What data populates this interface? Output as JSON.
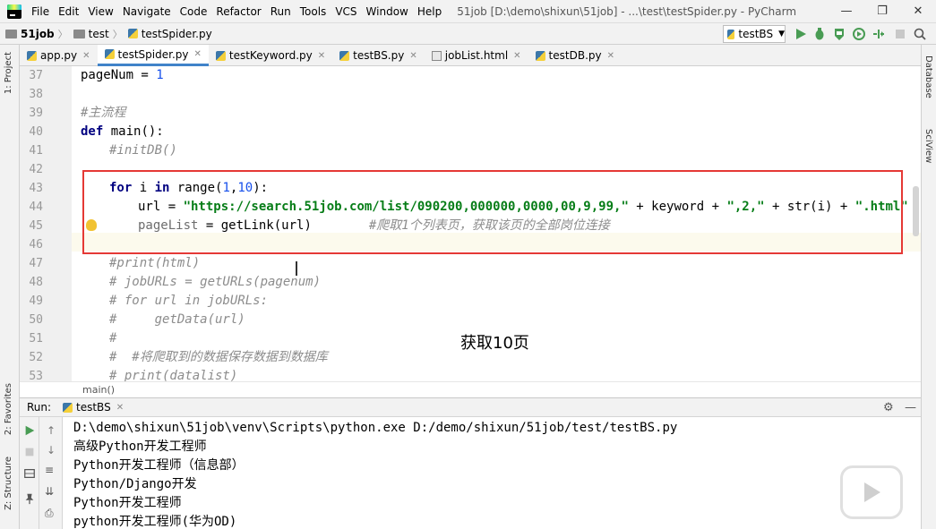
{
  "menubar": {
    "items": [
      "File",
      "Edit",
      "View",
      "Navigate",
      "Code",
      "Refactor",
      "Run",
      "Tools",
      "VCS",
      "Window",
      "Help"
    ],
    "window_title": "51job [D:\\demo\\shixun\\51job] - ...\\test\\testSpider.py - PyCharm",
    "minimize": "—",
    "maximize": "❐",
    "close": "✕"
  },
  "navbar": {
    "crumbs": [
      "51job",
      "test",
      "testSpider.py"
    ],
    "run_config": "testBS"
  },
  "tabs": [
    {
      "label": "app.py",
      "icon": "python-file-icon"
    },
    {
      "label": "testSpider.py",
      "icon": "python-file-icon"
    },
    {
      "label": "testKeyword.py",
      "icon": "python-file-icon"
    },
    {
      "label": "testBS.py",
      "icon": "python-file-icon"
    },
    {
      "label": "jobList.html",
      "icon": "html-file-icon"
    },
    {
      "label": "testDB.py",
      "icon": "python-file-icon"
    }
  ],
  "left_strip": {
    "project": "1: Project",
    "favorites": "2: Favorites",
    "structure": "Z: Structure"
  },
  "right_strip": {
    "database": "Database",
    "sciview": "SciView"
  },
  "editor": {
    "line_numbers": [
      "37",
      "38",
      "39",
      "40",
      "41",
      "42",
      "43",
      "44",
      "45",
      "46",
      "47",
      "48",
      "49",
      "50",
      "51",
      "52",
      "53"
    ],
    "l37a": "pageNum = ",
    "l37b": "1",
    "l39": "#主流程",
    "l40kw": "def",
    "l40": " main():",
    "l41": "#initDB()",
    "l43kw": "for",
    "l43a": " i ",
    "l43kw2": "in",
    "l43b": " range(",
    "l43n1": "1",
    "l43c": ",",
    "l43n2": "10",
    "l43d": "):",
    "l44a": "url = ",
    "l44str": "\"https://search.51job.com/list/090200,000000,0000,00,9,99,\"",
    "l44b": " + keyword + ",
    "l44str2": "\",2,\"",
    "l44c": " + str(i) + ",
    "l44str3": "\".html\"",
    "l45a": "pageList",
    "l45b": " = getLink(url)",
    "l45cmt": "#爬取1个列表页，获取该页的全部岗位连接",
    "l47": "#print(html)",
    "l48": "# jobURLs = getURLs(pagenum)",
    "l49": "# for url in jobURLs:",
    "l50": "#     getData(url)",
    "l51": "#",
    "l52": "#  #将爬取到的数据保存数据到数据库",
    "l53": "# print(datalist)",
    "breadcrumb": "main()"
  },
  "overlay_caption": "获取10页",
  "run_panel": {
    "label": "Run:",
    "tab": "testBS",
    "lines": [
      "D:\\demo\\shixun\\51job\\venv\\Scripts\\python.exe D:/demo/shixun/51job/test/testBS.py",
      "高级Python开发工程师",
      "Python开发工程师（信息部）",
      "Python/Django开发",
      "Python开发工程师",
      "python开发工程师(华为OD)"
    ]
  }
}
